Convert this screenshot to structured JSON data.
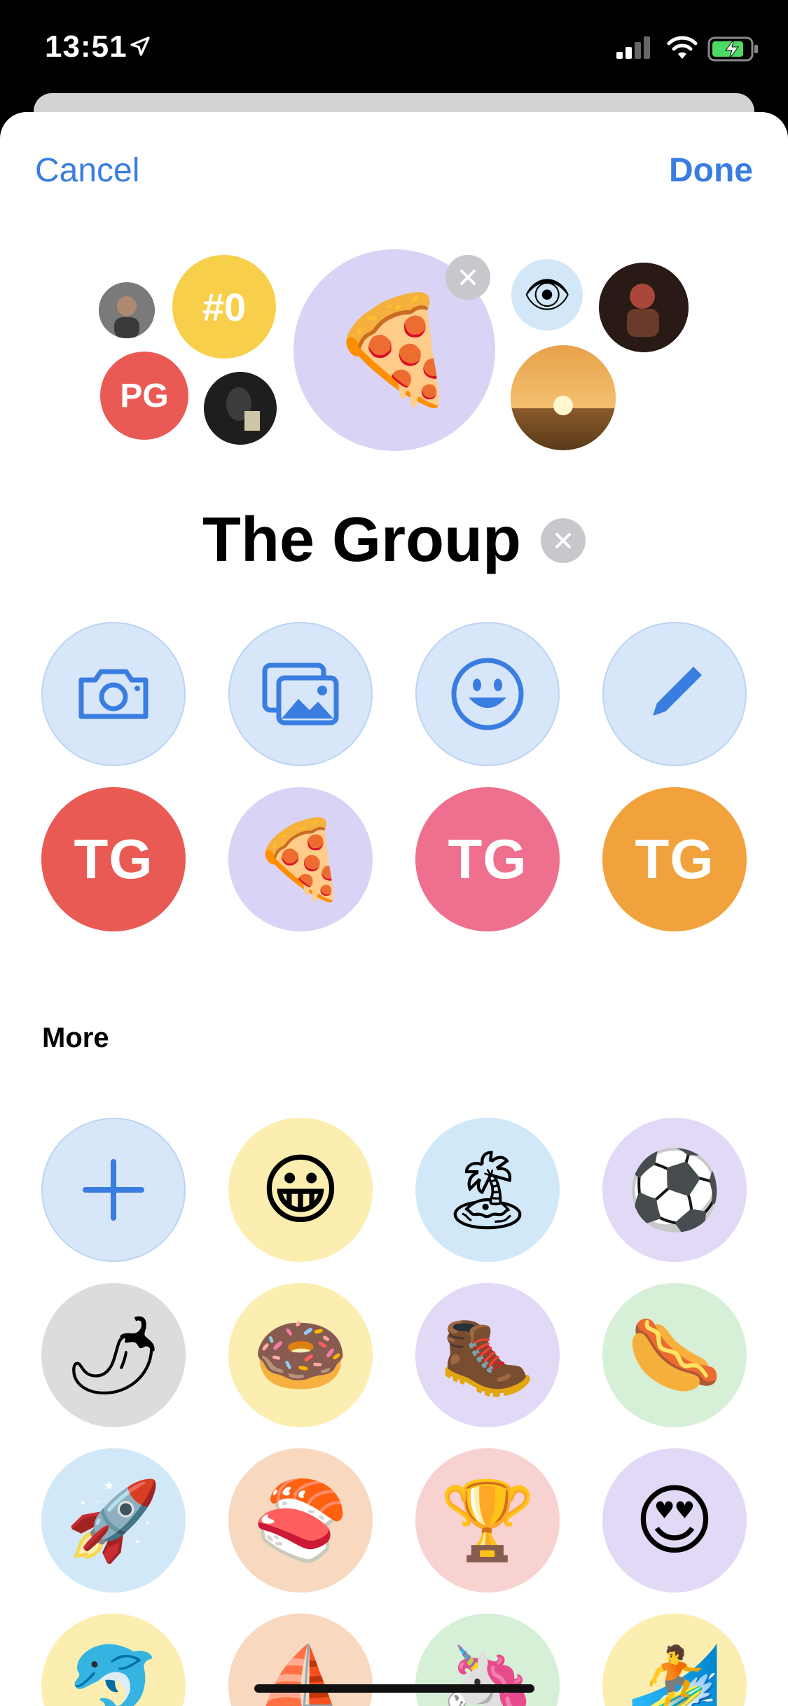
{
  "status": {
    "time": "13:51"
  },
  "nav": {
    "cancel": "Cancel",
    "done": "Done"
  },
  "group": {
    "name": "The Group",
    "avatars": [
      {
        "kind": "photo",
        "color": "#6b6b6b"
      },
      {
        "kind": "text",
        "text": "#0",
        "color": "#f7cf4a"
      },
      {
        "kind": "text",
        "text": "PG",
        "color": "#ea5a55"
      },
      {
        "kind": "photo",
        "color": "#2c2c2c"
      },
      {
        "kind": "emoji",
        "emoji": "🍕",
        "color": "#d9d3f6"
      },
      {
        "kind": "emoji",
        "emoji": "👁",
        "color": "#d2e8f8"
      },
      {
        "kind": "photo",
        "color": "#4a2a22"
      },
      {
        "kind": "photo",
        "color": "#d8963a"
      }
    ]
  },
  "actions": [
    {
      "name": "camera-icon"
    },
    {
      "name": "photos-icon"
    },
    {
      "name": "emoji-icon"
    },
    {
      "name": "pencil-icon"
    }
  ],
  "suggestions": [
    {
      "type": "text",
      "text": "TG",
      "color": "#ea5a55"
    },
    {
      "type": "emoji",
      "emoji": "🍕",
      "color": "#d9d3f6"
    },
    {
      "type": "text",
      "text": "TG",
      "color": "#ef6f8e"
    },
    {
      "type": "text",
      "text": "TG",
      "color": "#f1a23c"
    }
  ],
  "more": {
    "title": "More",
    "items": [
      {
        "type": "add",
        "color": "#d8e6fa"
      },
      {
        "type": "emoji",
        "emoji": "😀",
        "color": "#fbeeb0"
      },
      {
        "type": "emoji",
        "emoji": "🏝",
        "color": "#d1e8f8"
      },
      {
        "type": "emoji",
        "emoji": "⚽",
        "color": "#e1d9f6"
      },
      {
        "type": "emoji",
        "emoji": "🌶",
        "color": "#dcdcdd"
      },
      {
        "type": "emoji",
        "emoji": "🍩",
        "color": "#fbeeb0"
      },
      {
        "type": "emoji",
        "emoji": "🥾",
        "color": "#e1d9f6"
      },
      {
        "type": "emoji",
        "emoji": "🌭",
        "color": "#d6efd7"
      },
      {
        "type": "emoji",
        "emoji": "🚀",
        "color": "#d1e8f8"
      },
      {
        "type": "emoji",
        "emoji": "🍣",
        "color": "#f8d9c0"
      },
      {
        "type": "emoji",
        "emoji": "🏆",
        "color": "#f8d1d1"
      },
      {
        "type": "emoji",
        "emoji": "😍",
        "color": "#e1d9f6"
      },
      {
        "type": "emoji",
        "emoji": "🐬",
        "color": "#fbeeb0"
      },
      {
        "type": "emoji",
        "emoji": "⛵",
        "color": "#f8d9c0"
      },
      {
        "type": "emoji",
        "emoji": "🦄",
        "color": "#d6efd7"
      },
      {
        "type": "emoji",
        "emoji": "🏄",
        "color": "#fbeeb0"
      }
    ]
  }
}
